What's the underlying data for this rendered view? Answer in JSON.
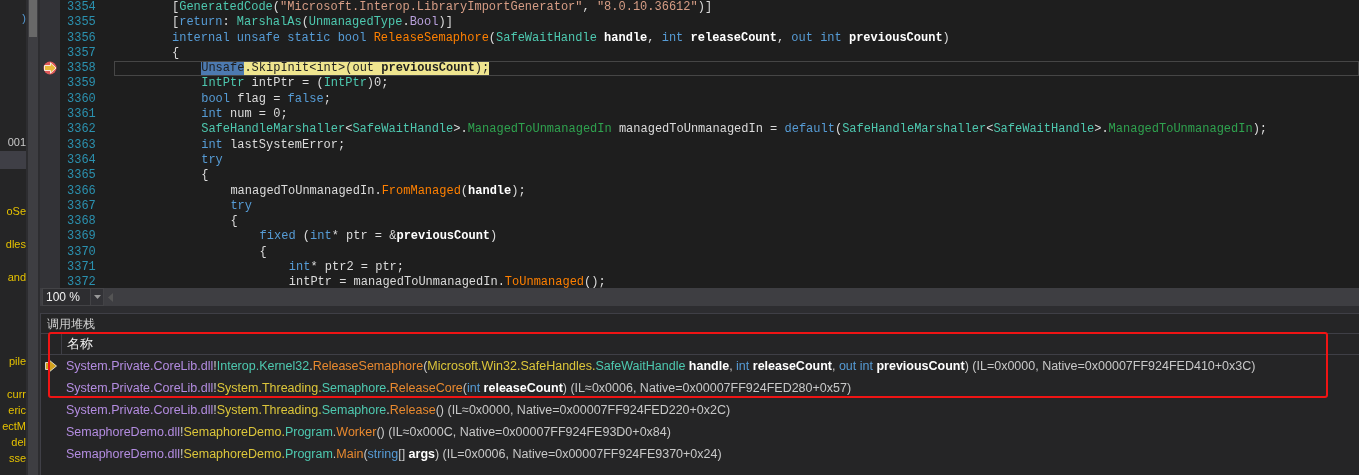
{
  "side_panel": {
    "fragments": [
      {
        "text": ")",
        "kind": "blue"
      },
      {
        "text": "001",
        "kind": "plain"
      },
      {
        "text": "oSe",
        "kind": "yellow"
      },
      {
        "text": "dles",
        "kind": "yellow"
      },
      {
        "text": "and",
        "kind": "yellow"
      },
      {
        "text": "pile",
        "kind": "yellow"
      },
      {
        "text": "curr",
        "kind": "yellow"
      },
      {
        "text": "eric",
        "kind": "yellow"
      },
      {
        "text": "ectM",
        "kind": "yellow"
      },
      {
        "text": "del",
        "kind": "yellow"
      },
      {
        "text": "sse",
        "kind": "yellow"
      }
    ]
  },
  "editor": {
    "lines": [
      {
        "number": "3354",
        "current": false,
        "segments": [
          {
            "kind": "plain",
            "text": "["
          },
          {
            "kind": "type",
            "text": "GeneratedCode"
          },
          {
            "kind": "plain",
            "text": "("
          },
          {
            "kind": "string",
            "text": "\"Microsoft.Interop.LibraryImportGenerator\""
          },
          {
            "kind": "plain",
            "text": ", "
          },
          {
            "kind": "string",
            "text": "\"8.0.10.36612\""
          },
          {
            "kind": "plain",
            "text": ")]"
          }
        ]
      },
      {
        "number": "3355",
        "current": false,
        "segments": [
          {
            "kind": "plain",
            "text": "["
          },
          {
            "kind": "keyword",
            "text": "return"
          },
          {
            "kind": "plain",
            "text": ": "
          },
          {
            "kind": "type",
            "text": "MarshalAs"
          },
          {
            "kind": "plain",
            "text": "("
          },
          {
            "kind": "type",
            "text": "UnmanagedType"
          },
          {
            "kind": "plain",
            "text": "."
          },
          {
            "kind": "enum",
            "text": "Bool"
          },
          {
            "kind": "plain",
            "text": ")]"
          }
        ]
      },
      {
        "number": "3356",
        "current": false,
        "segments": [
          {
            "kind": "keyword",
            "text": "internal unsafe static bool "
          },
          {
            "kind": "method",
            "text": "ReleaseSemaphore"
          },
          {
            "kind": "plain",
            "text": "("
          },
          {
            "kind": "type",
            "text": "SafeWaitHandle "
          },
          {
            "kind": "bold",
            "text": "handle"
          },
          {
            "kind": "plain",
            "text": ", "
          },
          {
            "kind": "keyword",
            "text": "int "
          },
          {
            "kind": "bold",
            "text": "releaseCount"
          },
          {
            "kind": "plain",
            "text": ", "
          },
          {
            "kind": "keyword",
            "text": "out int "
          },
          {
            "kind": "bold",
            "text": "previousCount"
          },
          {
            "kind": "plain",
            "text": ")"
          }
        ]
      },
      {
        "number": "3357",
        "current": false,
        "segments": [
          {
            "kind": "plain",
            "text": "{"
          }
        ],
        "children": [
          {
            "number": "3358",
            "current": true,
            "segments": [
              {
                "kind": "selected",
                "text": "Unsafe"
              },
              {
                "kind": "plain",
                "text": ".SkipInit<int>(out "
              },
              {
                "kind": "bold",
                "text": "previousCount"
              },
              {
                "kind": "plain",
                "text": ");"
              }
            ]
          },
          {
            "number": "3359",
            "current": false,
            "segments": [
              {
                "kind": "type",
                "text": "IntPtr"
              },
              {
                "kind": "plain",
                "text": " intPtr = ("
              },
              {
                "kind": "type",
                "text": "IntPtr"
              },
              {
                "kind": "plain",
                "text": ")0;"
              }
            ]
          },
          {
            "number": "3360",
            "current": false,
            "segments": [
              {
                "kind": "keyword",
                "text": "bool"
              },
              {
                "kind": "plain",
                "text": " flag = "
              },
              {
                "kind": "keyword",
                "text": "false"
              },
              {
                "kind": "plain",
                "text": ";"
              }
            ]
          },
          {
            "number": "3361",
            "current": false,
            "segments": [
              {
                "kind": "keyword",
                "text": "int"
              },
              {
                "kind": "plain",
                "text": " num = 0;"
              }
            ]
          },
          {
            "number": "3362",
            "current": false,
            "segments": [
              {
                "kind": "type",
                "text": "SafeHandleMarshaller"
              },
              {
                "kind": "plain",
                "text": "<"
              },
              {
                "kind": "type",
                "text": "SafeWaitHandle"
              },
              {
                "kind": "plain",
                "text": ">."
              },
              {
                "kind": "struct",
                "text": "ManagedToUnmanagedIn"
              },
              {
                "kind": "plain",
                "text": " managedToUnmanagedIn = "
              },
              {
                "kind": "keyword",
                "text": "default"
              },
              {
                "kind": "plain",
                "text": "("
              },
              {
                "kind": "type",
                "text": "SafeHandleMarshaller"
              },
              {
                "kind": "plain",
                "text": "<"
              },
              {
                "kind": "type",
                "text": "SafeWaitHandle"
              },
              {
                "kind": "plain",
                "text": ">."
              },
              {
                "kind": "struct",
                "text": "ManagedToUnmanagedIn"
              },
              {
                "kind": "plain",
                "text": ");"
              }
            ]
          },
          {
            "number": "3363",
            "current": false,
            "segments": [
              {
                "kind": "keyword",
                "text": "int"
              },
              {
                "kind": "plain",
                "text": " lastSystemError;"
              }
            ]
          },
          {
            "number": "3364",
            "current": false,
            "segments": [
              {
                "kind": "keyword",
                "text": "try"
              }
            ]
          },
          {
            "number": "3365",
            "current": false,
            "segments": [
              {
                "kind": "plain",
                "text": "{"
              }
            ],
            "children": [
              {
                "number": "3366",
                "current": false,
                "segments": [
                  {
                    "kind": "plain",
                    "text": "managedToUnmanagedIn."
                  },
                  {
                    "kind": "method",
                    "text": "FromManaged"
                  },
                  {
                    "kind": "plain",
                    "text": "("
                  },
                  {
                    "kind": "bold",
                    "text": "handle"
                  },
                  {
                    "kind": "plain",
                    "text": ");"
                  }
                ]
              },
              {
                "number": "3367",
                "current": false,
                "segments": [
                  {
                    "kind": "keyword",
                    "text": "try"
                  }
                ]
              },
              {
                "number": "3368",
                "current": false,
                "segments": [
                  {
                    "kind": "plain",
                    "text": "{"
                  }
                ],
                "children": [
                  {
                    "number": "3369",
                    "current": false,
                    "segments": [
                      {
                        "kind": "keyword",
                        "text": "fixed"
                      },
                      {
                        "kind": "plain",
                        "text": " ("
                      },
                      {
                        "kind": "keyword",
                        "text": "int"
                      },
                      {
                        "kind": "plain",
                        "text": "* ptr = &"
                      },
                      {
                        "kind": "bold",
                        "text": "previousCount"
                      },
                      {
                        "kind": "plain",
                        "text": ")"
                      }
                    ]
                  },
                  {
                    "number": "3370",
                    "current": false,
                    "segments": [
                      {
                        "kind": "plain",
                        "text": "{"
                      }
                    ],
                    "children": [
                      {
                        "number": "3371",
                        "current": false,
                        "segments": [
                          {
                            "kind": "keyword",
                            "text": "int"
                          },
                          {
                            "kind": "plain",
                            "text": "* ptr2 = ptr;"
                          }
                        ]
                      },
                      {
                        "number": "3372",
                        "current": false,
                        "segments": [
                          {
                            "kind": "plain",
                            "text": "intPtr = managedToUnmanagedIn."
                          },
                          {
                            "kind": "method",
                            "text": "ToUnmanaged"
                          },
                          {
                            "kind": "plain",
                            "text": "();"
                          }
                        ]
                      }
                    ]
                  }
                ]
              }
            ]
          }
        ]
      }
    ]
  },
  "zoom": {
    "value": "100 %"
  },
  "call_stack": {
    "title": "调用堆栈",
    "columns": [
      "名称"
    ],
    "rows": [
      {
        "current": true,
        "segments": [
          {
            "kind": "module",
            "text": "System.Private.CoreLib.dll"
          },
          {
            "kind": "plain",
            "text": "!"
          },
          {
            "kind": "ns",
            "text": "Interop.Kernel32"
          },
          {
            "kind": "plain",
            "text": "."
          },
          {
            "kind": "method",
            "text": "ReleaseSemaphore"
          },
          {
            "kind": "plain",
            "text": "("
          },
          {
            "kind": "ns2",
            "text": "Microsoft.Win32.SafeHandles."
          },
          {
            "kind": "type",
            "text": "SafeWaitHandle"
          },
          {
            "kind": "param",
            "text": " handle"
          },
          {
            "kind": "plain",
            "text": ", "
          },
          {
            "kind": "keyword",
            "text": "int"
          },
          {
            "kind": "param",
            "text": " releaseCount"
          },
          {
            "kind": "plain",
            "text": ", "
          },
          {
            "kind": "keyword",
            "text": "out int"
          },
          {
            "kind": "param",
            "text": " previousCount"
          },
          {
            "kind": "plain",
            "text": ") (IL=0x0000, Native=0x00007FF924FED410+0x3C)"
          }
        ]
      },
      {
        "current": false,
        "segments": [
          {
            "kind": "module",
            "text": "System.Private.CoreLib.dll"
          },
          {
            "kind": "plain",
            "text": "!"
          },
          {
            "kind": "ns2",
            "text": "System.Threading."
          },
          {
            "kind": "type",
            "text": "Semaphore"
          },
          {
            "kind": "plain",
            "text": "."
          },
          {
            "kind": "method",
            "text": "ReleaseCore"
          },
          {
            "kind": "plain",
            "text": "("
          },
          {
            "kind": "keyword",
            "text": "int"
          },
          {
            "kind": "param",
            "text": " releaseCount"
          },
          {
            "kind": "plain",
            "text": ") (IL≈0x0006, Native=0x00007FF924FED280+0x57)"
          }
        ]
      },
      {
        "current": false,
        "segments": [
          {
            "kind": "module",
            "text": "System.Private.CoreLib.dll"
          },
          {
            "kind": "plain",
            "text": "!"
          },
          {
            "kind": "ns2",
            "text": "System.Threading."
          },
          {
            "kind": "type",
            "text": "Semaphore"
          },
          {
            "kind": "plain",
            "text": "."
          },
          {
            "kind": "method",
            "text": "Release"
          },
          {
            "kind": "plain",
            "text": "() (IL≈0x0000, Native=0x00007FF924FED220+0x2C)"
          }
        ]
      },
      {
        "current": false,
        "segments": [
          {
            "kind": "module",
            "text": "SemaphoreDemo.dll"
          },
          {
            "kind": "plain",
            "text": "!"
          },
          {
            "kind": "ns2",
            "text": "SemaphoreDemo."
          },
          {
            "kind": "type",
            "text": "Program"
          },
          {
            "kind": "plain",
            "text": "."
          },
          {
            "kind": "method",
            "text": "Worker"
          },
          {
            "kind": "plain",
            "text": "() (IL≈0x000C, Native=0x00007FF924FE93D0+0x84)"
          }
        ]
      },
      {
        "current": false,
        "segments": [
          {
            "kind": "module",
            "text": "SemaphoreDemo.dll"
          },
          {
            "kind": "plain",
            "text": "!"
          },
          {
            "kind": "ns2",
            "text": "SemaphoreDemo."
          },
          {
            "kind": "type",
            "text": "Program"
          },
          {
            "kind": "plain",
            "text": "."
          },
          {
            "kind": "method",
            "text": "Main"
          },
          {
            "kind": "plain",
            "text": "("
          },
          {
            "kind": "keyword",
            "text": "string"
          },
          {
            "kind": "plain",
            "text": "[] "
          },
          {
            "kind": "param",
            "text": "args"
          },
          {
            "kind": "plain",
            "text": ") (IL=0x0006, Native=0x00007FF924FE9370+0x24)"
          }
        ]
      }
    ]
  }
}
